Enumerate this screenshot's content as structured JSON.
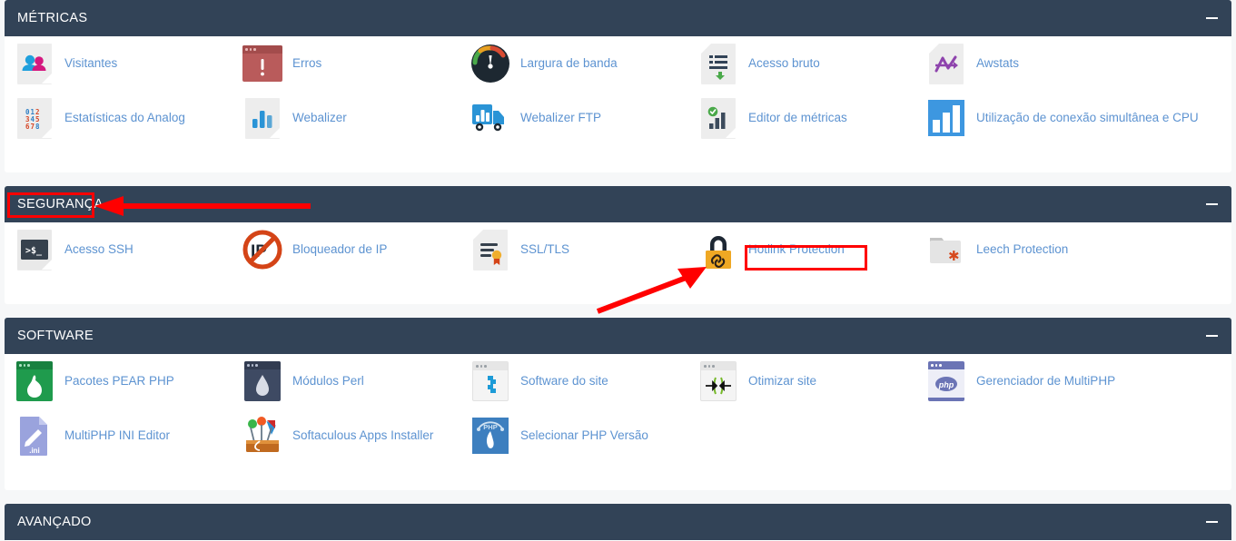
{
  "page": {
    "background": "#f6f7f8",
    "panel_header_bg": "#324357",
    "link_color": "#5d93d1",
    "annotation_color": "#ff0000"
  },
  "sections": [
    {
      "title": "MÉTRICAS",
      "collapse_icon": "minus-icon",
      "items": [
        {
          "label": "Visitantes",
          "icon": "visitors-icon"
        },
        {
          "label": "Erros",
          "icon": "errors-icon"
        },
        {
          "label": "Largura de banda",
          "icon": "bandwidth-gauge-icon"
        },
        {
          "label": "Acesso bruto",
          "icon": "raw-access-icon"
        },
        {
          "label": "Awstats",
          "icon": "awstats-icon"
        },
        {
          "label": "Estatísticas do Analog",
          "icon": "analog-stats-icon"
        },
        {
          "label": "Webalizer",
          "icon": "webalizer-icon"
        },
        {
          "label": "Webalizer FTP",
          "icon": "webalizer-ftp-icon"
        },
        {
          "label": "Editor de métricas",
          "icon": "metrics-editor-icon"
        },
        {
          "label": "Utilização de conexão simultânea e CPU",
          "icon": "cpu-connection-icon"
        }
      ]
    },
    {
      "title": "SEGURANÇA",
      "collapse_icon": "minus-icon",
      "items": [
        {
          "label": "Acesso SSH",
          "icon": "ssh-terminal-icon"
        },
        {
          "label": "Bloqueador de IP",
          "icon": "ip-blocker-icon"
        },
        {
          "label": "SSL/TLS",
          "icon": "ssl-certificate-icon"
        },
        {
          "label": "Hotlink Protection",
          "icon": "hotlink-padlock-icon"
        },
        {
          "label": "Leech Protection",
          "icon": "leech-folder-icon"
        }
      ]
    },
    {
      "title": "SOFTWARE",
      "collapse_icon": "minus-icon",
      "items": [
        {
          "label": "Pacotes PEAR PHP",
          "icon": "pear-php-icon"
        },
        {
          "label": "Módulos Perl",
          "icon": "perl-modules-icon"
        },
        {
          "label": "Software do site",
          "icon": "site-software-icon"
        },
        {
          "label": "Otimizar site",
          "icon": "optimize-site-icon"
        },
        {
          "label": "Gerenciador de MultiPHP",
          "icon": "multiphp-manager-icon"
        },
        {
          "label": "MultiPHP INI Editor",
          "icon": "multiphp-ini-editor-icon"
        },
        {
          "label": "Softaculous Apps Installer",
          "icon": "softaculous-icon"
        },
        {
          "label": "Selecionar PHP Versão",
          "icon": "select-php-version-icon"
        }
      ]
    },
    {
      "title": "AVANÇADO",
      "collapse_icon": "minus-icon",
      "items": []
    }
  ],
  "annotations": [
    {
      "name": "seguranca-highlight-box",
      "shape": "rectangle",
      "target": "SEGURANÇA"
    },
    {
      "name": "seguranca-arrow",
      "shape": "arrow-left",
      "target": "SEGURANÇA"
    },
    {
      "name": "hotlink-label-box",
      "shape": "rectangle",
      "target": "Hotlink Protection"
    },
    {
      "name": "hotlink-arrow",
      "shape": "arrow-diagonal",
      "target": "Hotlink Protection icon"
    }
  ]
}
